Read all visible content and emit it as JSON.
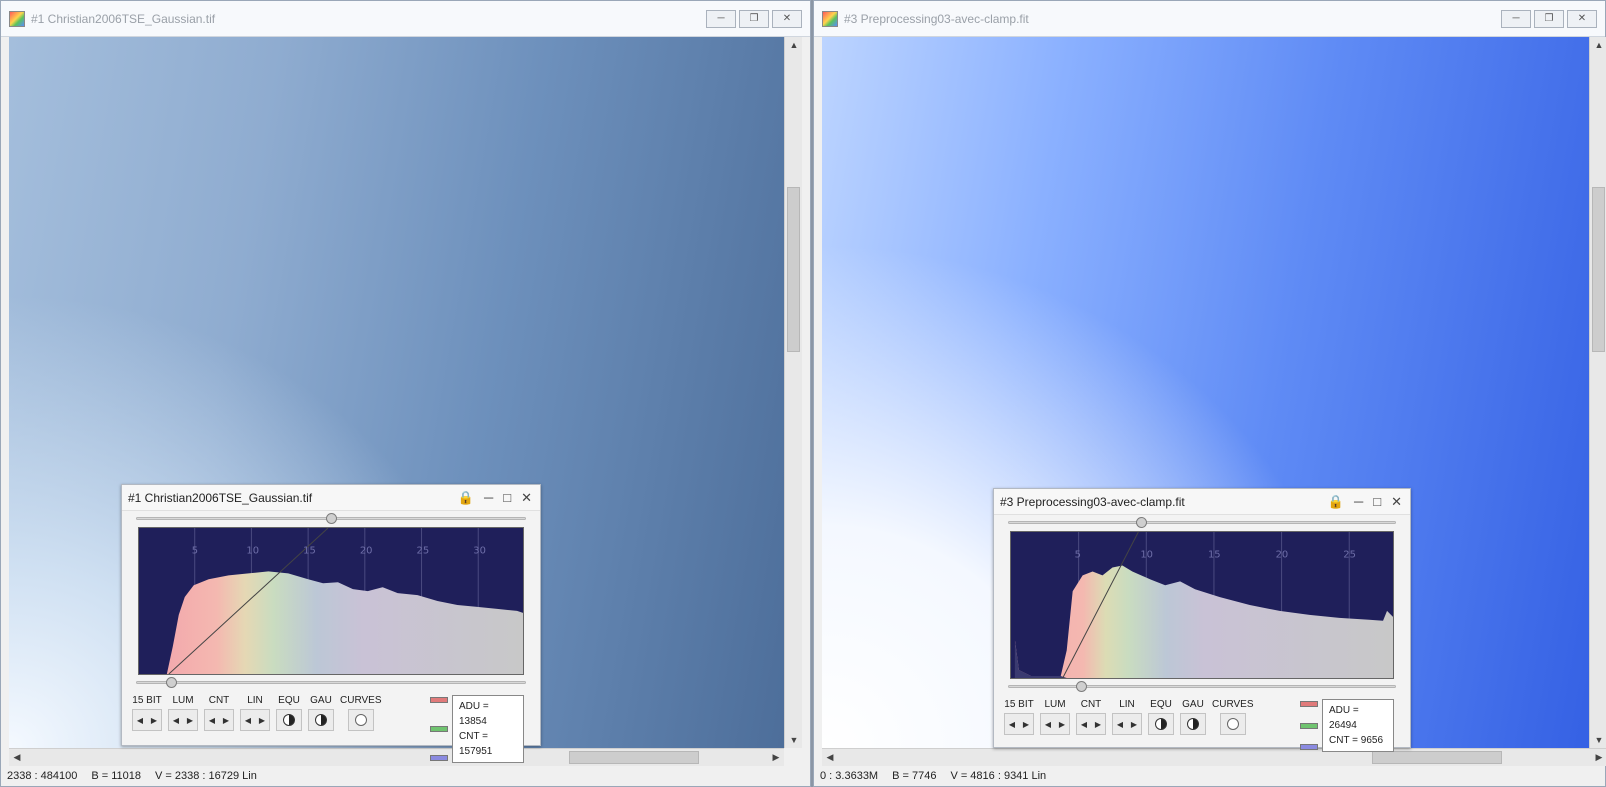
{
  "windows": [
    {
      "title": "#1 Christian2006TSE_Gaussian.tif",
      "status": {
        "coords": "2338 : 484100",
        "b": "B = 11018",
        "v": "V = 2338 : 16729 Lin"
      },
      "histogram": {
        "title": "#1 Christian2006TSE_Gaussian.tif",
        "ticks": [
          "5",
          "10",
          "15",
          "20",
          "25",
          "30"
        ],
        "controls": [
          "15 BIT",
          "LUM",
          "CNT",
          "LIN",
          "EQU",
          "GAU",
          "CURVES"
        ],
        "adu": "ADU = 13854",
        "cnt": "CNT = 157951",
        "top_slider_level": 0.5,
        "bottom_slider_level": 0.08
      }
    },
    {
      "title": "#3 Preprocessing03-avec-clamp.fit",
      "status": {
        "coords": "0 : 3.3633M",
        "b": "B = 7746",
        "v": "V = 4816 : 9341 Lin"
      },
      "histogram": {
        "title": "#3 Preprocessing03-avec-clamp.fit",
        "ticks": [
          "5",
          "10",
          "15",
          "20",
          "25"
        ],
        "controls": [
          "15 BIT",
          "LUM",
          "CNT",
          "LIN",
          "EQU",
          "GAU",
          "CURVES"
        ],
        "adu": "ADU = 26494",
        "cnt": "CNT = 9656",
        "top_slider_level": 0.34,
        "bottom_slider_level": 0.18
      }
    }
  ],
  "icons": {
    "minimize": "minimize-icon",
    "restore": "restore-icon",
    "close": "close-icon",
    "lock": "lock-icon"
  }
}
